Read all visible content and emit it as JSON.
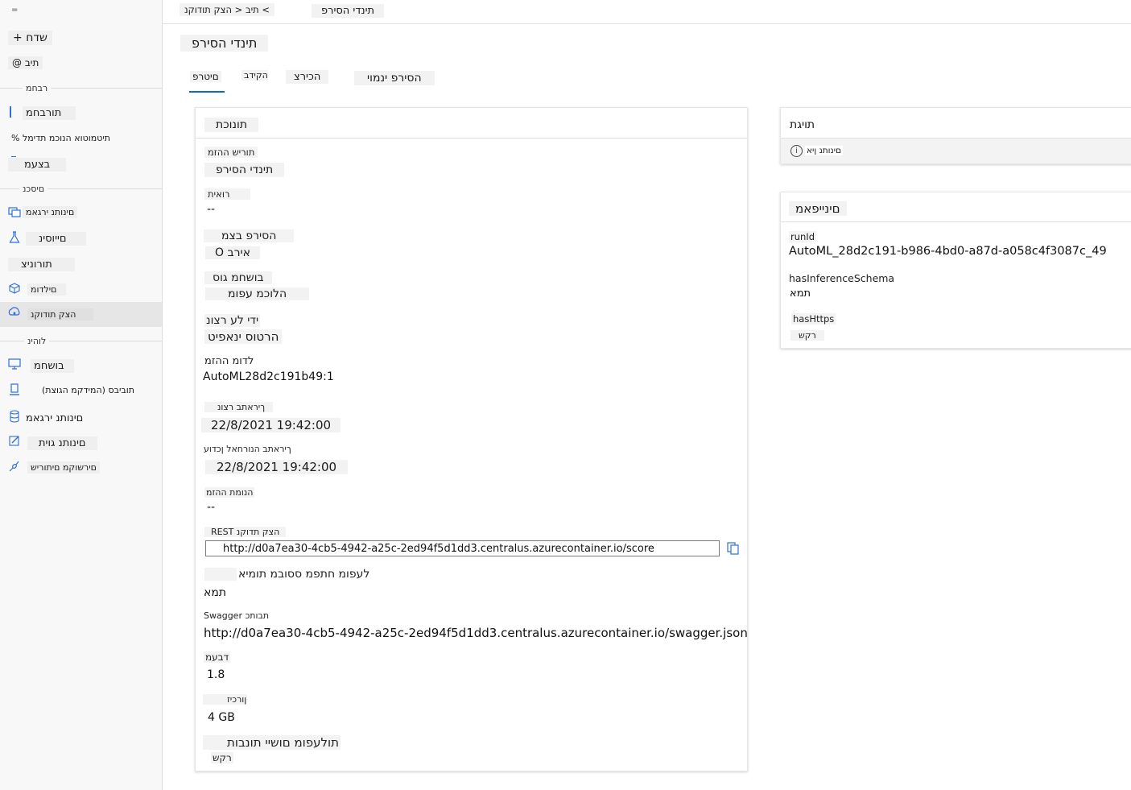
{
  "sidebar": {
    "hamburger": "=",
    "new_button": "+ שדח",
    "home": "@ תיב",
    "section_author": "רבחמ",
    "item_notebooks": "תורבחמ",
    "item_automl": "% תיטמוטוא הנוכמ תדימל",
    "item_designer": "בצעמ",
    "section_assets": "םיסכנ",
    "item_datasets": "םינותנ ירגאמ",
    "item_experiments": "םייוסינ",
    "item_pipelines": "תורוניצ",
    "item_models": "םילדומ",
    "item_endpoints": "הצק תודוקנ",
    "section_manage": "לוהינ",
    "item_compute": "בושחמ",
    "item_environments": "(המידקמ הגוצת) תוביבס",
    "item_datastores": "םינותנ ירגאמ",
    "item_labeling": "םינותנ גוית",
    "item_linked": "םירשוקמ םיתוריש"
  },
  "header": {
    "breadcrumb": "תיב < הצק תודוקנ <",
    "breadcrumb_current": "תינדי הסירפ",
    "page_title": "תינדי הסירפ"
  },
  "tabs": [
    {
      "label": "םיטרפ"
    },
    {
      "label": "הקידב"
    },
    {
      "label": "הכירצ"
    },
    {
      "label": "הסירפ ינמוי"
    }
  ],
  "attributes": {
    "heading": "תונוכת",
    "service_id_label": "תוריש ההזמ",
    "service_id_value": "תינדי הסירפ",
    "description_label": "רואית",
    "description_value": "--",
    "deploy_state_label": "הסירפ בצמ",
    "deploy_state_value": "O אירב",
    "compute_type_label": "בושחמ גוס",
    "compute_type_value": "הלוכמ עפומ",
    "created_by_label": "ידי לע רצונ",
    "created_by_value": "הרטוס ינאפיט",
    "model_id_label": "לדומ ההזמ",
    "model_id_value": "AutoML28d2c191b49:1",
    "created_on_label": "ךיראתב רצונ",
    "created_on_value": "22/8/2021 19:42:00",
    "updated_on_label": "ךיראתב הנורחאל ןכדוע",
    "updated_on_value": "22/8/2021 19:42:00",
    "image_id_label": "הנומת ההזמ",
    "image_id_value": "--",
    "rest_label": "REST הצק תדוקנ",
    "rest_value": "http://d0a7ea30-4cb5-4942-a25c-2ed94f5d1dd3.centralus.azurecontainer.io/score",
    "key_auth_label": "לעפומ חתפמ ססובמ תומיא",
    "key_auth_value": "תמא",
    "swagger_label": "Swagger תבותכ",
    "swagger_value": "http://d0a7ea30-4cb5-4942-a25c-2ed94f5d1dd3.centralus.azurecontainer.io/swagger.json",
    "cpu_label": "דבעמ",
    "cpu_value": "1.8",
    "memory_label": "ןורכיז",
    "memory_value": "4 GB",
    "app_insights_label": "תולעפומ םושיי תונבות",
    "app_insights_value": "רקש"
  },
  "tags_card": {
    "heading": "תויגת",
    "empty": "םינותנ ןיא"
  },
  "properties_card": {
    "heading": "םינייפאמ",
    "run_id_label": "runId",
    "run_id_value": "AutoML_28d2c191-b986-4bd0-a87d-a058c4f3087c_49",
    "has_schema_label": "hasInferenceSchema",
    "has_schema_value": "תמא",
    "has_https_label": "hasHttps",
    "has_https_value": "רקש"
  },
  "colors": {
    "accent": "#2f6fd6",
    "active_tab_underline": "#0f6cbd",
    "sidebar_bg": "#f8f8f8"
  }
}
